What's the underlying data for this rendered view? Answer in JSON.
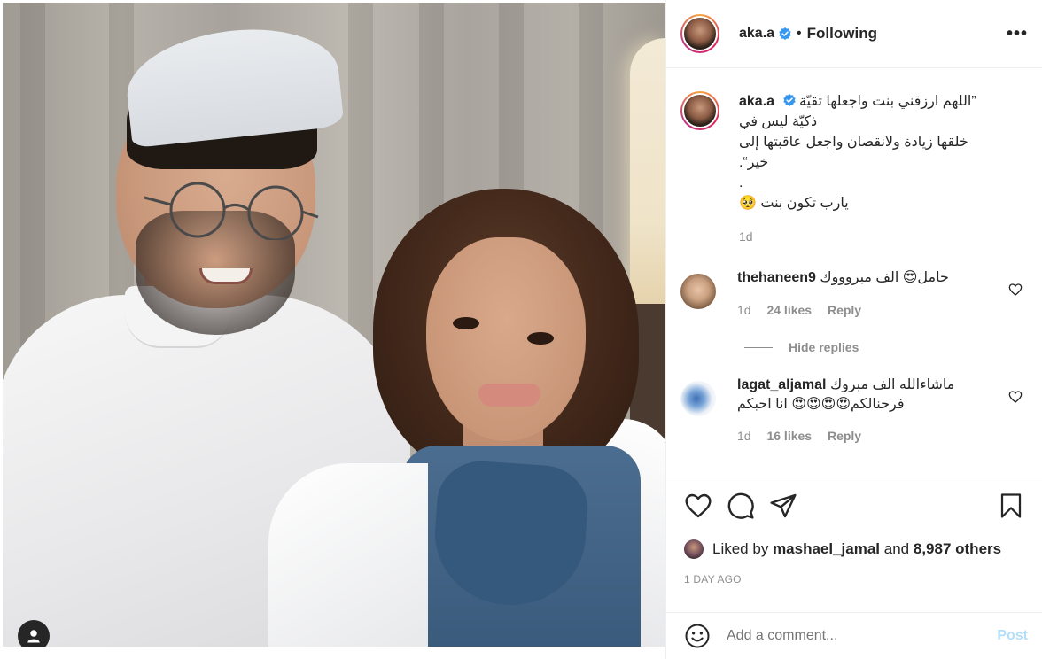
{
  "post": {
    "username": "aka.a",
    "follow_status": "Following",
    "more_icon": "more-options-icon",
    "caption_lines": [
      "”اللهم ارزقني بنت واجعلها تقيّة ذكيّة ليس في",
      "خلقها زيادة ولانقصان واجعل عاقبتها إلى",
      "خير“.",
      ".",
      "يارب تكون بنت 🥺"
    ],
    "caption_time": "1d"
  },
  "comments": [
    {
      "username": "thehaneen9",
      "text": "حامل😍 الف مبروووك",
      "time": "1d",
      "likes": "24 likes",
      "reply": "Reply"
    },
    {
      "username": "lagat_aljamal",
      "text_line1": "ماشاءالله الف مبروك",
      "text_line2": "فرحنالكم😍😍😍😍 انا احبكم",
      "time": "1d",
      "likes": "16 likes",
      "reply": "Reply"
    }
  ],
  "hide_replies": "Hide replies",
  "likes": {
    "prefix": "Liked by",
    "user": "mashael_jamal",
    "and": "and",
    "others": "8,987 others"
  },
  "posted_ago": "1 DAY AGO",
  "add_comment": {
    "placeholder": "Add a comment...",
    "post_label": "Post"
  },
  "icons": {
    "like": "heart-icon",
    "comment": "comment-icon",
    "share": "share-icon",
    "save": "bookmark-icon",
    "emoji": "emoji-icon",
    "verified": "verified-badge-icon",
    "user_tag": "user-tag-icon"
  },
  "colors": {
    "text": "#262626",
    "muted": "#8e8e8e",
    "verified": "#3897f0",
    "post_disabled": "#b2dffc",
    "border": "#efefef"
  }
}
